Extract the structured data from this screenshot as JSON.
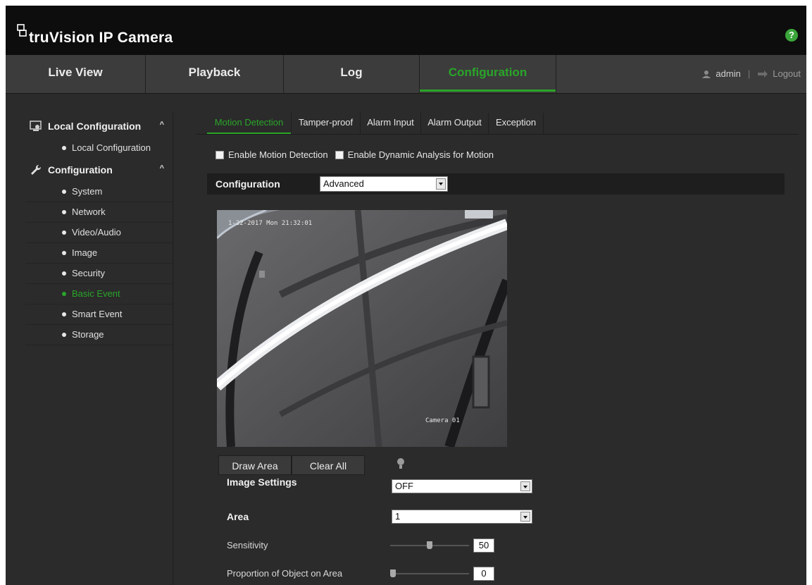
{
  "app": {
    "brand_name": "truVision IP Camera",
    "help_symbol": "?"
  },
  "nav": {
    "tabs": [
      {
        "label": "Live View"
      },
      {
        "label": "Playback"
      },
      {
        "label": "Log"
      },
      {
        "label": "Configuration"
      }
    ],
    "user": "admin",
    "separator": "|",
    "logout": "Logout"
  },
  "sidebar": {
    "groups": [
      {
        "label": "Local Configuration",
        "items": [
          "Local Configuration"
        ]
      },
      {
        "label": "Configuration",
        "items": [
          "System",
          "Network",
          "Video/Audio",
          "Image",
          "Security",
          "Basic Event",
          "Smart Event",
          "Storage"
        ]
      }
    ],
    "active_item": "Basic Event"
  },
  "tabs": [
    "Motion Detection",
    "Tamper-proof",
    "Alarm Input",
    "Alarm Output",
    "Exception"
  ],
  "options": {
    "enable_motion": "Enable Motion Detection",
    "enable_dynamic": "Enable Dynamic Analysis for Motion"
  },
  "configuration": {
    "label": "Configuration",
    "value": "Advanced"
  },
  "video": {
    "timestamp": "1-22-2017 Mon 21:32:01",
    "camera_label": "Camera 01"
  },
  "buttons": {
    "draw_area": "Draw Area",
    "clear_all": "Clear All"
  },
  "image_settings": {
    "label": "Image Settings",
    "value": "OFF"
  },
  "area": {
    "label": "Area",
    "value": "1"
  },
  "sensitivity": {
    "label": "Sensitivity",
    "value": "50",
    "fraction": 0.5
  },
  "proportion": {
    "label": "Proportion of Object on Area",
    "value": "0",
    "fraction": 0.0
  },
  "colors": {
    "accent": "#2aa52a",
    "background": "#2b2b2b",
    "header": "#0d0d0d"
  }
}
